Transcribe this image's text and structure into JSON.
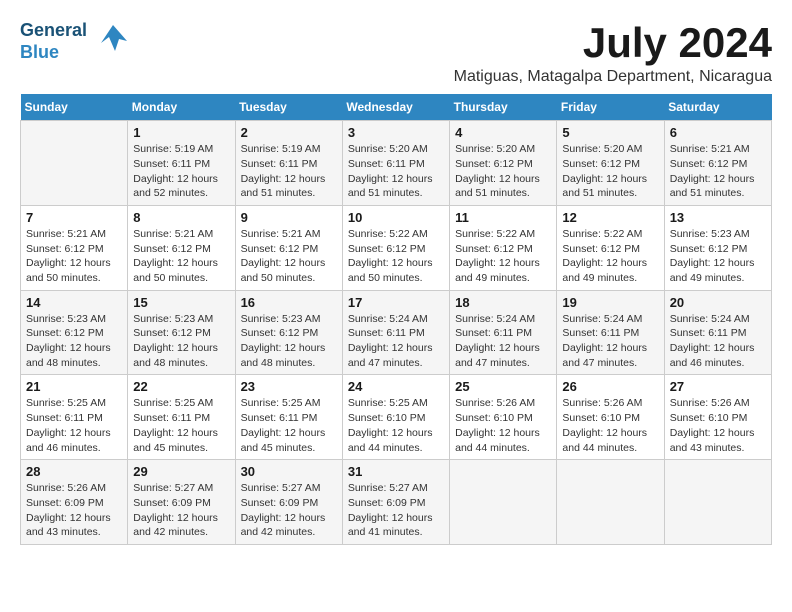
{
  "logo": {
    "line1": "General",
    "line2": "Blue"
  },
  "title": {
    "month_year": "July 2024",
    "location": "Matiguas, Matagalpa Department, Nicaragua"
  },
  "weekdays": [
    "Sunday",
    "Monday",
    "Tuesday",
    "Wednesday",
    "Thursday",
    "Friday",
    "Saturday"
  ],
  "weeks": [
    [
      {
        "day": "",
        "sunrise": "",
        "sunset": "",
        "daylight": ""
      },
      {
        "day": "1",
        "sunrise": "Sunrise: 5:19 AM",
        "sunset": "Sunset: 6:11 PM",
        "daylight": "Daylight: 12 hours and 52 minutes."
      },
      {
        "day": "2",
        "sunrise": "Sunrise: 5:19 AM",
        "sunset": "Sunset: 6:11 PM",
        "daylight": "Daylight: 12 hours and 51 minutes."
      },
      {
        "day": "3",
        "sunrise": "Sunrise: 5:20 AM",
        "sunset": "Sunset: 6:11 PM",
        "daylight": "Daylight: 12 hours and 51 minutes."
      },
      {
        "day": "4",
        "sunrise": "Sunrise: 5:20 AM",
        "sunset": "Sunset: 6:12 PM",
        "daylight": "Daylight: 12 hours and 51 minutes."
      },
      {
        "day": "5",
        "sunrise": "Sunrise: 5:20 AM",
        "sunset": "Sunset: 6:12 PM",
        "daylight": "Daylight: 12 hours and 51 minutes."
      },
      {
        "day": "6",
        "sunrise": "Sunrise: 5:21 AM",
        "sunset": "Sunset: 6:12 PM",
        "daylight": "Daylight: 12 hours and 51 minutes."
      }
    ],
    [
      {
        "day": "7",
        "sunrise": "Sunrise: 5:21 AM",
        "sunset": "Sunset: 6:12 PM",
        "daylight": "Daylight: 12 hours and 50 minutes."
      },
      {
        "day": "8",
        "sunrise": "Sunrise: 5:21 AM",
        "sunset": "Sunset: 6:12 PM",
        "daylight": "Daylight: 12 hours and 50 minutes."
      },
      {
        "day": "9",
        "sunrise": "Sunrise: 5:21 AM",
        "sunset": "Sunset: 6:12 PM",
        "daylight": "Daylight: 12 hours and 50 minutes."
      },
      {
        "day": "10",
        "sunrise": "Sunrise: 5:22 AM",
        "sunset": "Sunset: 6:12 PM",
        "daylight": "Daylight: 12 hours and 50 minutes."
      },
      {
        "day": "11",
        "sunrise": "Sunrise: 5:22 AM",
        "sunset": "Sunset: 6:12 PM",
        "daylight": "Daylight: 12 hours and 49 minutes."
      },
      {
        "day": "12",
        "sunrise": "Sunrise: 5:22 AM",
        "sunset": "Sunset: 6:12 PM",
        "daylight": "Daylight: 12 hours and 49 minutes."
      },
      {
        "day": "13",
        "sunrise": "Sunrise: 5:23 AM",
        "sunset": "Sunset: 6:12 PM",
        "daylight": "Daylight: 12 hours and 49 minutes."
      }
    ],
    [
      {
        "day": "14",
        "sunrise": "Sunrise: 5:23 AM",
        "sunset": "Sunset: 6:12 PM",
        "daylight": "Daylight: 12 hours and 48 minutes."
      },
      {
        "day": "15",
        "sunrise": "Sunrise: 5:23 AM",
        "sunset": "Sunset: 6:12 PM",
        "daylight": "Daylight: 12 hours and 48 minutes."
      },
      {
        "day": "16",
        "sunrise": "Sunrise: 5:23 AM",
        "sunset": "Sunset: 6:12 PM",
        "daylight": "Daylight: 12 hours and 48 minutes."
      },
      {
        "day": "17",
        "sunrise": "Sunrise: 5:24 AM",
        "sunset": "Sunset: 6:11 PM",
        "daylight": "Daylight: 12 hours and 47 minutes."
      },
      {
        "day": "18",
        "sunrise": "Sunrise: 5:24 AM",
        "sunset": "Sunset: 6:11 PM",
        "daylight": "Daylight: 12 hours and 47 minutes."
      },
      {
        "day": "19",
        "sunrise": "Sunrise: 5:24 AM",
        "sunset": "Sunset: 6:11 PM",
        "daylight": "Daylight: 12 hours and 47 minutes."
      },
      {
        "day": "20",
        "sunrise": "Sunrise: 5:24 AM",
        "sunset": "Sunset: 6:11 PM",
        "daylight": "Daylight: 12 hours and 46 minutes."
      }
    ],
    [
      {
        "day": "21",
        "sunrise": "Sunrise: 5:25 AM",
        "sunset": "Sunset: 6:11 PM",
        "daylight": "Daylight: 12 hours and 46 minutes."
      },
      {
        "day": "22",
        "sunrise": "Sunrise: 5:25 AM",
        "sunset": "Sunset: 6:11 PM",
        "daylight": "Daylight: 12 hours and 45 minutes."
      },
      {
        "day": "23",
        "sunrise": "Sunrise: 5:25 AM",
        "sunset": "Sunset: 6:11 PM",
        "daylight": "Daylight: 12 hours and 45 minutes."
      },
      {
        "day": "24",
        "sunrise": "Sunrise: 5:25 AM",
        "sunset": "Sunset: 6:10 PM",
        "daylight": "Daylight: 12 hours and 44 minutes."
      },
      {
        "day": "25",
        "sunrise": "Sunrise: 5:26 AM",
        "sunset": "Sunset: 6:10 PM",
        "daylight": "Daylight: 12 hours and 44 minutes."
      },
      {
        "day": "26",
        "sunrise": "Sunrise: 5:26 AM",
        "sunset": "Sunset: 6:10 PM",
        "daylight": "Daylight: 12 hours and 44 minutes."
      },
      {
        "day": "27",
        "sunrise": "Sunrise: 5:26 AM",
        "sunset": "Sunset: 6:10 PM",
        "daylight": "Daylight: 12 hours and 43 minutes."
      }
    ],
    [
      {
        "day": "28",
        "sunrise": "Sunrise: 5:26 AM",
        "sunset": "Sunset: 6:09 PM",
        "daylight": "Daylight: 12 hours and 43 minutes."
      },
      {
        "day": "29",
        "sunrise": "Sunrise: 5:27 AM",
        "sunset": "Sunset: 6:09 PM",
        "daylight": "Daylight: 12 hours and 42 minutes."
      },
      {
        "day": "30",
        "sunrise": "Sunrise: 5:27 AM",
        "sunset": "Sunset: 6:09 PM",
        "daylight": "Daylight: 12 hours and 42 minutes."
      },
      {
        "day": "31",
        "sunrise": "Sunrise: 5:27 AM",
        "sunset": "Sunset: 6:09 PM",
        "daylight": "Daylight: 12 hours and 41 minutes."
      },
      {
        "day": "",
        "sunrise": "",
        "sunset": "",
        "daylight": ""
      },
      {
        "day": "",
        "sunrise": "",
        "sunset": "",
        "daylight": ""
      },
      {
        "day": "",
        "sunrise": "",
        "sunset": "",
        "daylight": ""
      }
    ]
  ]
}
